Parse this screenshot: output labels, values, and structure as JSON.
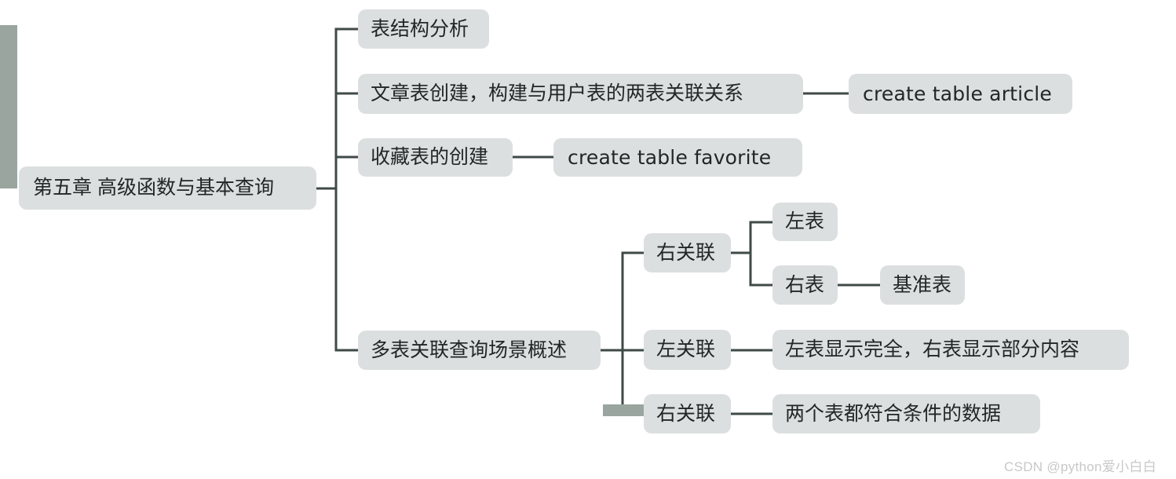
{
  "diagram": {
    "type": "mindmap",
    "title": "第五章 高级函数与基本查询",
    "orientation": "left-to-right",
    "colors": {
      "node_background": "#dcdfe0",
      "node_text": "#222626",
      "connector": "#3f4a47",
      "handle": "#9aa5a0",
      "canvas": "#ffffff",
      "watermark": "#c8c8c8"
    },
    "root": {
      "label": "第五章 高级函数与基本查询"
    },
    "nodes": [
      {
        "id": "n1",
        "label": "表结构分析",
        "level": 1
      },
      {
        "id": "n2",
        "label": "文章表创建，构建与用户表的两表关联关系",
        "level": 1
      },
      {
        "id": "n2a",
        "label": "create table article",
        "level": 2,
        "style": "mono"
      },
      {
        "id": "n3",
        "label": "收藏表的创建",
        "level": 1
      },
      {
        "id": "n3a",
        "label": "create table favorite",
        "level": 2,
        "style": "mono"
      },
      {
        "id": "n4",
        "label": "多表关联查询场景概述",
        "level": 1
      },
      {
        "id": "n4a",
        "label": "右关联",
        "level": 2
      },
      {
        "id": "n4a1",
        "label": "左表",
        "level": 3
      },
      {
        "id": "n4a2",
        "label": "右表",
        "level": 3
      },
      {
        "id": "n4a2a",
        "label": "基准表",
        "level": 4
      },
      {
        "id": "n4b",
        "label": "左关联",
        "level": 2
      },
      {
        "id": "n4b1",
        "label": "左表显示完全，右表显示部分内容",
        "level": 3
      },
      {
        "id": "n4c",
        "label": "右关联",
        "level": 2
      },
      {
        "id": "n4c1",
        "label": "两个表都符合条件的数据",
        "level": 3
      }
    ]
  },
  "watermark": {
    "text": "CSDN @python爱小白白"
  }
}
